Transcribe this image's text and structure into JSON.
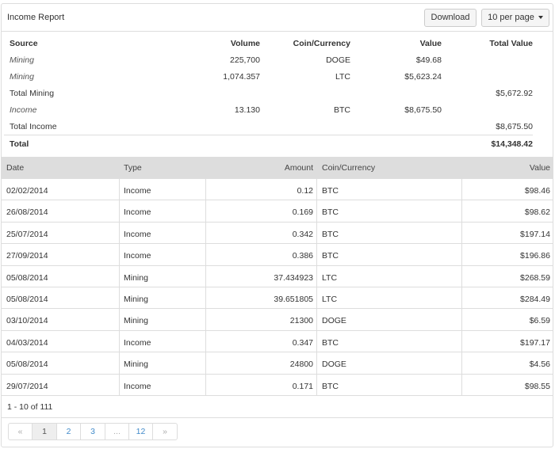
{
  "header": {
    "title": "Income Report",
    "download_label": "Download",
    "per_page_label": "10 per page"
  },
  "summary": {
    "columns": {
      "source": "Source",
      "volume": "Volume",
      "coin": "Coin/Currency",
      "value": "Value",
      "total": "Total Value"
    },
    "rows": [
      {
        "source": "Mining",
        "volume": "225,700",
        "coin": "DOGE",
        "value": "$49.68",
        "total": ""
      },
      {
        "source": "Mining",
        "volume": "1,074.357",
        "coin": "LTC",
        "value": "$5,623.24",
        "total": ""
      },
      {
        "source": "Total Mining",
        "volume": "",
        "coin": "",
        "value": "",
        "total": "$5,672.92"
      },
      {
        "source": "Income",
        "volume": "13.130",
        "coin": "BTC",
        "value": "$8,675.50",
        "total": ""
      },
      {
        "source": "Total Income",
        "volume": "",
        "coin": "",
        "value": "",
        "total": "$8,675.50"
      }
    ],
    "grand_total_label": "Total",
    "grand_total_value": "$14,348.42"
  },
  "transactions": {
    "columns": {
      "date": "Date",
      "type": "Type",
      "amount": "Amount",
      "coin": "Coin/Currency",
      "value": "Value"
    },
    "rows": [
      {
        "date": "02/02/2014",
        "type": "Income",
        "amount": "0.12",
        "coin": "BTC",
        "value": "$98.46"
      },
      {
        "date": "26/08/2014",
        "type": "Income",
        "amount": "0.169",
        "coin": "BTC",
        "value": "$98.62"
      },
      {
        "date": "25/07/2014",
        "type": "Income",
        "amount": "0.342",
        "coin": "BTC",
        "value": "$197.14"
      },
      {
        "date": "27/09/2014",
        "type": "Income",
        "amount": "0.386",
        "coin": "BTC",
        "value": "$196.86"
      },
      {
        "date": "05/08/2014",
        "type": "Mining",
        "amount": "37.434923",
        "coin": "LTC",
        "value": "$268.59"
      },
      {
        "date": "05/08/2014",
        "type": "Mining",
        "amount": "39.651805",
        "coin": "LTC",
        "value": "$284.49"
      },
      {
        "date": "03/10/2014",
        "type": "Mining",
        "amount": "21300",
        "coin": "DOGE",
        "value": "$6.59"
      },
      {
        "date": "04/03/2014",
        "type": "Income",
        "amount": "0.347",
        "coin": "BTC",
        "value": "$197.17"
      },
      {
        "date": "05/08/2014",
        "type": "Mining",
        "amount": "24800",
        "coin": "DOGE",
        "value": "$4.56"
      },
      {
        "date": "29/07/2014",
        "type": "Income",
        "amount": "0.171",
        "coin": "BTC",
        "value": "$98.55"
      }
    ]
  },
  "pagination": {
    "count_text": "1 - 10 of 111",
    "prev": "«",
    "pages": [
      "1",
      "2",
      "3",
      "...",
      "12"
    ],
    "active_page": "1",
    "next": "»"
  },
  "colors": {
    "link": "#428bca",
    "header_bg": "#dddddd",
    "border": "#dddddd"
  }
}
